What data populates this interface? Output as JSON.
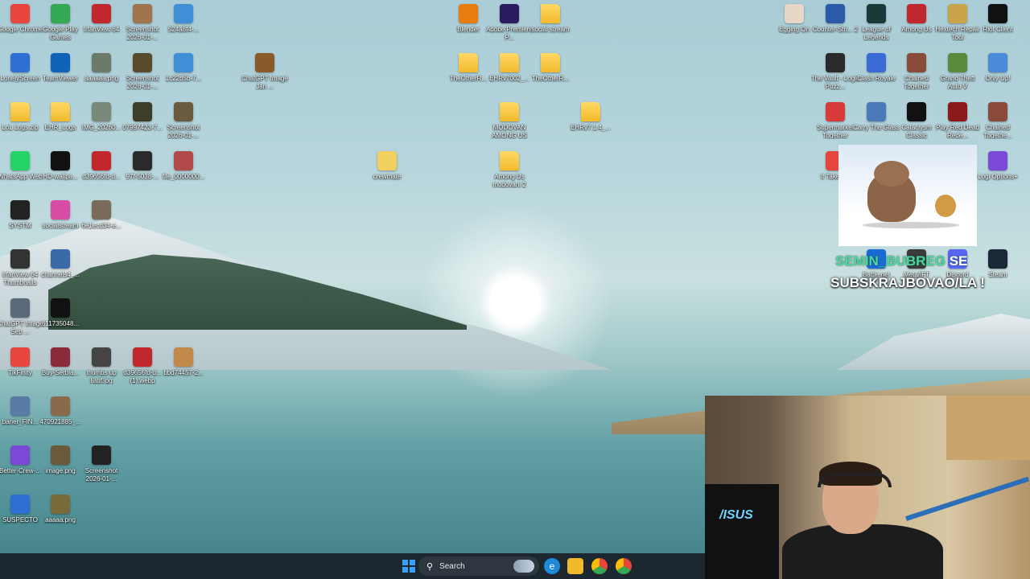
{
  "desktop": {
    "icons": [
      {
        "label": "Google Chrome",
        "icon": "chrome-icon",
        "color": "#e8453c"
      },
      {
        "label": "Google Play Games",
        "icon": "play-games-icon",
        "color": "#34a853"
      },
      {
        "label": "IrfanView 64",
        "icon": "irfanview-icon",
        "color": "#c0282d"
      },
      {
        "label": "Screenshot 2026-01-...",
        "icon": "image-file-icon",
        "color": "#a0744a"
      },
      {
        "label": "524a8f4-...",
        "icon": "image-file-icon",
        "color": "#3e8fd6"
      },
      {
        "label": "LonelyScreen",
        "icon": "lonelyscreen-icon",
        "color": "#2d6fd3"
      },
      {
        "label": "TeamViewer",
        "icon": "teamviewer-icon",
        "color": "#0e62b8"
      },
      {
        "label": "aaaaaa.png",
        "icon": "image-file-icon",
        "color": "#6c7a6a"
      },
      {
        "label": "Screenshot 2026-01-...",
        "icon": "image-file-icon",
        "color": "#5a4a2c"
      },
      {
        "label": "1c22d5b-7...",
        "icon": "image-file-icon",
        "color": "#3e8fd6"
      },
      {
        "label": "ChatGPT Image Jan ...",
        "icon": "image-file-icon",
        "color": "#8a5a2a"
      },
      {
        "label": "LoL Logs.zip",
        "icon": "zip-folder-icon",
        "color": "#f2b92b"
      },
      {
        "label": "EHR_Logs",
        "icon": "folder-icon",
        "color": "#f2b92b"
      },
      {
        "label": "IMG_20260...",
        "icon": "image-file-icon",
        "color": "#7a8a7a"
      },
      {
        "label": "07997423-7...",
        "icon": "image-file-icon",
        "color": "#3d3d2a"
      },
      {
        "label": "Screenshot 2026-01-...",
        "icon": "image-file-icon",
        "color": "#6a5a40"
      },
      {
        "label": "WhatsApp Web",
        "icon": "whatsapp-icon",
        "color": "#25d366"
      },
      {
        "label": "HD-wallpa...",
        "icon": "image-file-icon",
        "color": "#111111"
      },
      {
        "label": "d39656fd-d...",
        "icon": "image-file-icon",
        "color": "#c0282d"
      },
      {
        "label": "97f-5038-...",
        "icon": "image-file-icon",
        "color": "#2a2a2a"
      },
      {
        "label": "file_0000000...",
        "icon": "image-file-icon",
        "color": "#b04a4a"
      },
      {
        "label": "crewmate",
        "icon": "image-file-icon",
        "color": "#f2d060"
      },
      {
        "label": "SYSTM",
        "icon": "systm-icon",
        "color": "#222222"
      },
      {
        "label": "socialstream",
        "icon": "socialstream-icon",
        "color": "#d94ca6"
      },
      {
        "label": "6e1ecd34-e...",
        "icon": "image-file-icon",
        "color": "#7a6a5a"
      },
      {
        "label": "IrfanView 64 Thumbnails",
        "icon": "irfanview-thumbnails-icon",
        "color": "#333333"
      },
      {
        "label": "channels4_...",
        "icon": "image-file-icon",
        "color": "#3a6aa8"
      },
      {
        "label": "ChatGPT Image Sep ...",
        "icon": "image-file-icon",
        "color": "#5a6a7a"
      },
      {
        "label": "611735048...",
        "icon": "image-file-icon",
        "color": "#111111"
      },
      {
        "label": "TikFinity",
        "icon": "tikfinity-icon",
        "color": "#e8453c"
      },
      {
        "label": "Buy-Serbia...",
        "icon": "image-file-icon",
        "color": "#8a2a3a"
      },
      {
        "label": "thumbs up ljatif.jpg",
        "icon": "image-file-icon",
        "color": "#444444"
      },
      {
        "label": "d39656fd-d... (1).webp",
        "icon": "image-file-icon",
        "color": "#c0282d"
      },
      {
        "label": "bbd74457-2...",
        "icon": "image-file-icon",
        "color": "#c28a4a"
      },
      {
        "label": "baner_FIN...",
        "icon": "image-file-icon",
        "color": "#5a7aa8"
      },
      {
        "label": "470921885_...",
        "icon": "image-file-icon",
        "color": "#8a6a4a"
      },
      {
        "label": "Better-Crew-...",
        "icon": "better-crewlink-icon",
        "color": "#7a4ad6"
      },
      {
        "label": "image.png",
        "icon": "image-file-icon",
        "color": "#6a5a3a"
      },
      {
        "label": "Screenshot 2026-01-...",
        "icon": "image-file-icon",
        "color": "#222222"
      },
      {
        "label": "SUSPECTO",
        "icon": "suspecto-icon",
        "color": "#2d6fd3"
      },
      {
        "label": "aaaaa.png",
        "icon": "image-file-icon",
        "color": "#7a6a3a"
      },
      {
        "label": "Blender",
        "icon": "blender-icon",
        "color": "#e87d0d"
      },
      {
        "label": "Adobe Premiere P...",
        "icon": "premiere-icon",
        "color": "#2a1a5e"
      },
      {
        "label": "social stream",
        "icon": "folder-icon",
        "color": "#f2b92b"
      },
      {
        "label": "TheOtherR...",
        "icon": "folder-icon",
        "color": "#f2b92b"
      },
      {
        "label": "EHRv7002_...",
        "icon": "folder-icon",
        "color": "#f2b92b"
      },
      {
        "label": "TheOtherR...",
        "icon": "folder-icon",
        "color": "#f2b92b"
      },
      {
        "label": "MODOVAN AMONG US",
        "icon": "folder-icon",
        "color": "#f2b92b"
      },
      {
        "label": "EHRv7.1.4_...",
        "icon": "folder-icon",
        "color": "#f2b92b"
      },
      {
        "label": "Among Us modovani 2",
        "icon": "folder-icon",
        "color": "#f2b92b"
      },
      {
        "label": "Egging On",
        "icon": "egg-icon",
        "color": "#e8d6c6"
      },
      {
        "label": "Counter-Stri... 2",
        "icon": "counter-strike-icon",
        "color": "#2a5aa8"
      },
      {
        "label": "League of Legends",
        "icon": "league-icon",
        "color": "#1a3a3a"
      },
      {
        "label": "Among Us",
        "icon": "among-us-icon",
        "color": "#c0282d"
      },
      {
        "label": "Hextech Repair Tool",
        "icon": "hextech-icon",
        "color": "#c9a44a"
      },
      {
        "label": "Riot Client",
        "icon": "riot-icon",
        "color": "#111111"
      },
      {
        "label": "The Vault - Logic Puzz...",
        "icon": "game-icon",
        "color": "#2a2a2a"
      },
      {
        "label": "Clash Royale",
        "icon": "game-icon",
        "color": "#3a6ad6"
      },
      {
        "label": "Chained Together",
        "icon": "game-icon",
        "color": "#8a4a3a"
      },
      {
        "label": "Grand Theft Auto V",
        "icon": "gta-icon",
        "color": "#5a8a3a"
      },
      {
        "label": "Only Up!",
        "icon": "game-icon",
        "color": "#4a8ad6"
      },
      {
        "label": "Supermarket Together",
        "icon": "game-icon",
        "color": "#d63a3a"
      },
      {
        "label": "Carry The Glass",
        "icon": "game-icon",
        "color": "#4a7ab8"
      },
      {
        "label": "Cataclysm Classic",
        "icon": "game-icon",
        "color": "#111111"
      },
      {
        "label": "Play Red Dead Rede...",
        "icon": "game-icon",
        "color": "#8a1a1a"
      },
      {
        "label": "Chained Togethe...",
        "icon": "game-icon",
        "color": "#8a4a3a"
      },
      {
        "label": "It Takes ...",
        "icon": "game-icon",
        "color": "#e8453c"
      },
      {
        "label": "Logi Options+",
        "icon": "logi-icon",
        "color": "#7a4ad6"
      },
      {
        "label": "Battle.net",
        "icon": "battlenet-icon",
        "color": "#1a6ad6"
      },
      {
        "label": "Meta/IFT",
        "icon": "game-icon",
        "color": "#3a3a3a"
      },
      {
        "label": "Discord",
        "icon": "discord-icon",
        "color": "#5865f2"
      },
      {
        "label": "Steam",
        "icon": "steam-icon",
        "color": "#1b2838"
      }
    ]
  },
  "overlay": {
    "name_text": "SEMIN_BUBREG",
    "name_suffix": "SE",
    "sub_text": "SUBSKRAJBOVAO/LA !"
  },
  "taskbar": {
    "search_placeholder": "Search",
    "items": [
      {
        "icon": "windows-start-icon",
        "color": "#3aa0ff"
      },
      {
        "icon": "edge-icon",
        "color": "#1f8ad6"
      },
      {
        "icon": "file-explorer-icon",
        "color": "#f2b92b"
      },
      {
        "icon": "chrome-icon",
        "color": "#e8453c"
      },
      {
        "icon": "chrome-alt-icon",
        "color": "#e8453c"
      }
    ]
  }
}
